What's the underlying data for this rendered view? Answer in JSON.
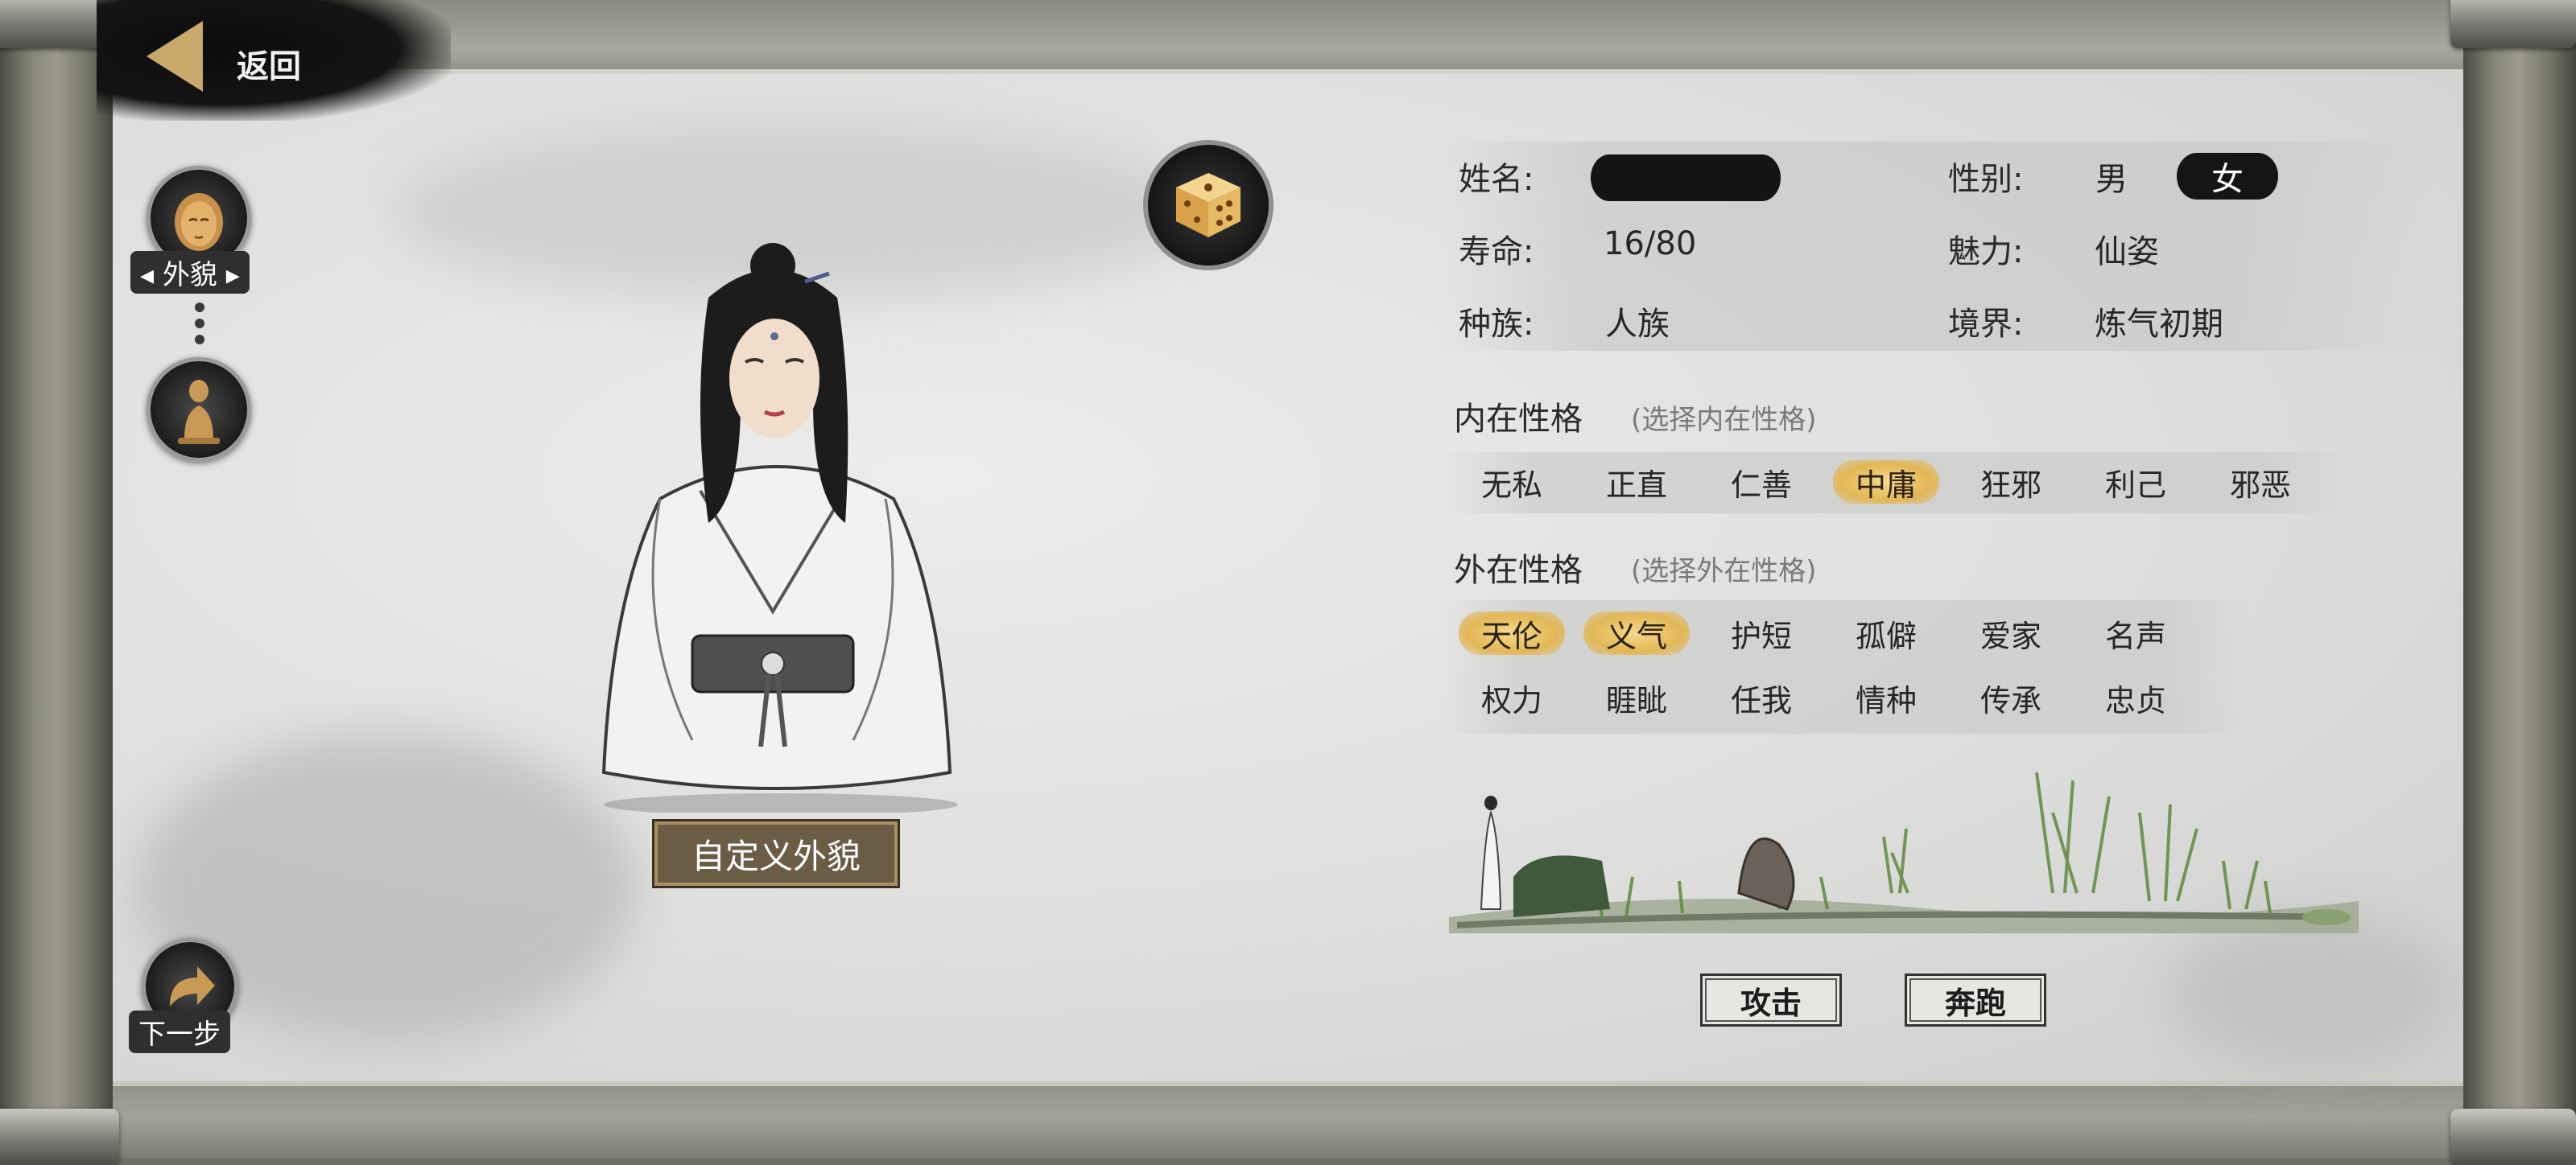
{
  "nav": {
    "back_label": "返回"
  },
  "steps": [
    {
      "label": "外貌",
      "icon": "face-portrait-icon",
      "active": true
    },
    {
      "label": "",
      "icon": "pawn-figure-icon",
      "active": false
    }
  ],
  "next": {
    "label": "下一步"
  },
  "character": {
    "customize_label": "自定义外貌"
  },
  "info": {
    "name_label": "姓名:",
    "name_value": "",
    "gender_label": "性别:",
    "gender_options": [
      "男",
      "女"
    ],
    "gender_selected": "女",
    "lifespan_label": "寿命:",
    "lifespan_value": "16/80",
    "charm_label": "魅力:",
    "charm_value": "仙姿",
    "race_label": "种族:",
    "race_value": "人族",
    "realm_label": "境界:",
    "realm_value": "炼气初期"
  },
  "inner_personality": {
    "title": "内在性格",
    "hint": "(选择内在性格)",
    "options": [
      "无私",
      "正直",
      "仁善",
      "中庸",
      "狂邪",
      "利己",
      "邪恶"
    ],
    "selected": [
      "中庸"
    ]
  },
  "outer_personality": {
    "title": "外在性格",
    "hint": "(选择外在性格)",
    "rows": [
      [
        "天伦",
        "义气",
        "护短",
        "孤僻",
        "爱家",
        "名声"
      ],
      [
        "权力",
        "睚眦",
        "任我",
        "情种",
        "传承",
        "忠贞"
      ]
    ],
    "selected": [
      "天伦",
      "义气"
    ]
  },
  "actions": {
    "attack_label": "攻击",
    "flee_label": "奔跑"
  },
  "colors": {
    "trait_selected": "#e2b756",
    "gender_selected_bg": "#151515",
    "button_border": "#6a5c45"
  }
}
